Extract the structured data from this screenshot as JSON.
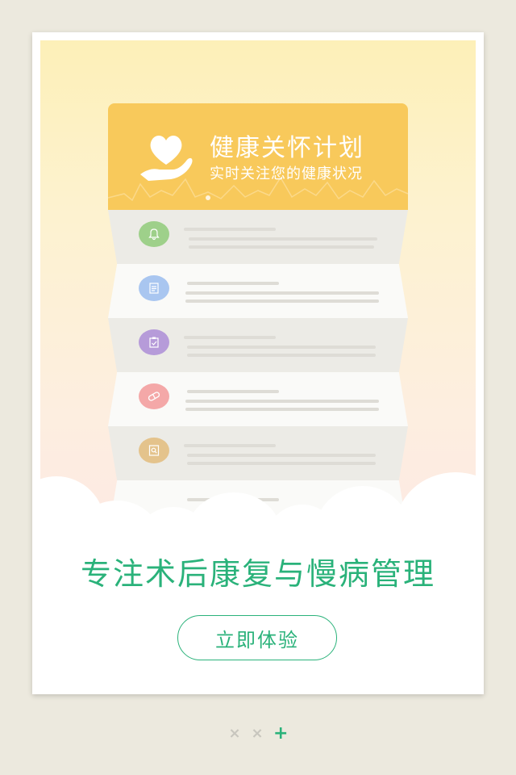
{
  "banner": {
    "title": "健康关怀计划",
    "subtitle": "实时关注您的健康状况",
    "logo_icon": "heart-hand-icon",
    "color": "#f8c95b"
  },
  "list_items": [
    {
      "icon": "bell-icon",
      "color": "#9ed08a"
    },
    {
      "icon": "document-icon",
      "color": "#a9c6f0"
    },
    {
      "icon": "clipboard-check-icon",
      "color": "#b69bd9"
    },
    {
      "icon": "pill-icon",
      "color": "#f4a8a8"
    },
    {
      "icon": "search-document-icon",
      "color": "#e4c38c"
    }
  ],
  "headline": "专注术后康复与慢病管理",
  "cta": {
    "label": "立即体验",
    "color": "#2ab27a"
  },
  "pager": {
    "dots": [
      {
        "symbol": "×",
        "state": "inactive",
        "color": "#c8c6be"
      },
      {
        "symbol": "×",
        "state": "inactive",
        "color": "#c8c6be"
      },
      {
        "symbol": "+",
        "state": "active",
        "color": "#2ab27a"
      }
    ]
  }
}
